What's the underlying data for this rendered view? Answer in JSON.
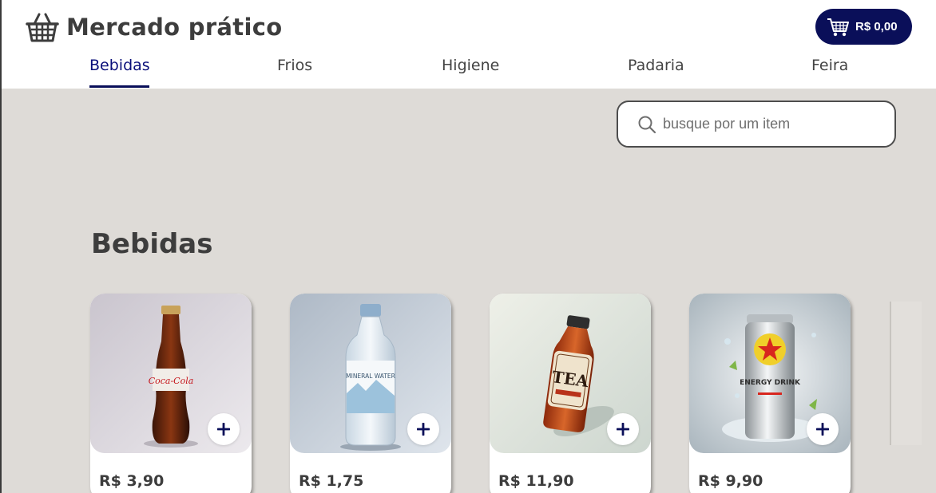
{
  "header": {
    "title": "Mercado prático",
    "logo_icon": "shopping-basket-icon",
    "cart_total": "R$ 0,00",
    "cart_icon": "shopping-cart-icon"
  },
  "tabs": [
    {
      "label": "Bebidas",
      "active": true
    },
    {
      "label": "Frios",
      "active": false
    },
    {
      "label": "Higiene",
      "active": false
    },
    {
      "label": "Padaria",
      "active": false
    },
    {
      "label": "Feira",
      "active": false
    }
  ],
  "search": {
    "placeholder": "busque por um item",
    "value": "",
    "icon": "search-icon"
  },
  "section": {
    "title": "Bebidas"
  },
  "products": [
    {
      "price": "R$ 3,90",
      "image": "cola-bottle",
      "bottle_label": "Coca-Cola"
    },
    {
      "price": "R$ 1,75",
      "image": "mineral-water-bottle",
      "bottle_label": "MINERAL WATER"
    },
    {
      "price": "R$ 11,90",
      "image": "iced-tea-bottle",
      "bottle_label": "TEA"
    },
    {
      "price": "R$ 9,90",
      "image": "energy-drink-can",
      "bottle_label": "ENERGY DRINK"
    }
  ],
  "colors": {
    "accent": "#0a0f59",
    "page_background": "#dedbd7",
    "text": "#3d3d3d"
  }
}
